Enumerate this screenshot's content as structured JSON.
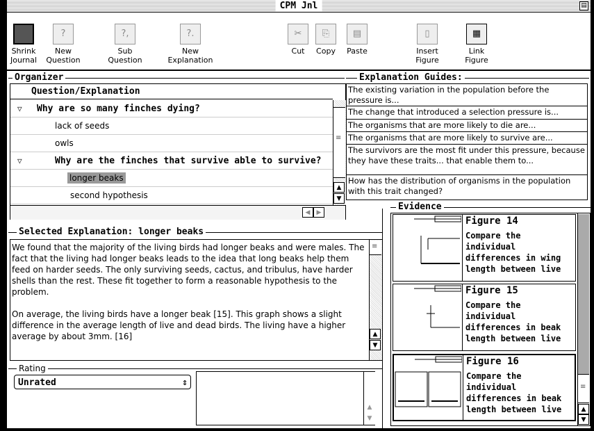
{
  "window": {
    "title": "CPM Jnl"
  },
  "toolbar": [
    {
      "label": "Shrink\nJournal",
      "icon": "shrink-journal-icon",
      "enabled": true
    },
    {
      "label": "New\nQuestion",
      "icon": "new-question-icon",
      "enabled": false
    },
    {
      "label": "Sub\nQuestion",
      "icon": "sub-question-icon",
      "enabled": false
    },
    {
      "label": "New\nExplanation",
      "icon": "new-explanation-icon",
      "enabled": false
    },
    {
      "label": "Cut",
      "icon": "cut-icon",
      "enabled": false
    },
    {
      "label": "Copy",
      "icon": "copy-icon",
      "enabled": false
    },
    {
      "label": "Paste",
      "icon": "paste-icon",
      "enabled": false
    },
    {
      "label": "Insert\nFigure",
      "icon": "insert-figure-icon",
      "enabled": false
    },
    {
      "label": "Link\nFigure",
      "icon": "link-figure-icon",
      "enabled": true
    }
  ],
  "organizer": {
    "label": "Organizer",
    "column_header": "Question/Explanation",
    "rows": [
      {
        "type": "question",
        "text": "Why are so many finches dying?"
      },
      {
        "type": "explanation",
        "text": "lack of seeds"
      },
      {
        "type": "explanation",
        "text": "owls"
      },
      {
        "type": "question",
        "text": "Why are the finches that survive able to survive?"
      },
      {
        "type": "explanation",
        "text": "longer beaks",
        "selected": true
      },
      {
        "type": "explanation",
        "text": "second hypothesis"
      }
    ]
  },
  "guides": {
    "label": "Explanation Guides:",
    "items": [
      "The existing variation in the population before the pressure is...",
      "The change that introduced a selection pressure is...",
      "The organisms that are more likely to die are...",
      "The organisms that are more likely to survive are...",
      "The survivors are the most fit under this pressure, because they have these traits... that enable them to...",
      "How has the distribution of organisms in the population with this trait changed?"
    ]
  },
  "explanation": {
    "label": "Selected Explanation: longer beaks",
    "text": "We found that the majority of the living birds had longer beaks and were males. The fact that the living had longer beaks leads to the idea that long beaks help them feed on harder seeds. The only surviving seeds, cactus, and tribulus, have harder shells than the rest. These fit together to form a reasonable hypothesis to the problem.\n\nOn average, the living birds have a longer beak [15]. This graph shows a slight difference in the average length of live and dead birds. The living have a higher average by about 3mm. [16]"
  },
  "rating": {
    "label": "Rating",
    "value": "Unrated"
  },
  "evidence": {
    "label": "Evidence",
    "figures": [
      {
        "title": "Figure 14",
        "desc": "Compare the\nindividual\ndifferences in wing\nlength between live"
      },
      {
        "title": "Figure 15",
        "desc": "Compare the\nindividual\ndifferences in beak\nlength between live"
      },
      {
        "title": "Figure 16",
        "desc": "Compare the\nindividual\ndifferences in beak\nlength between live",
        "selected": true
      }
    ]
  }
}
